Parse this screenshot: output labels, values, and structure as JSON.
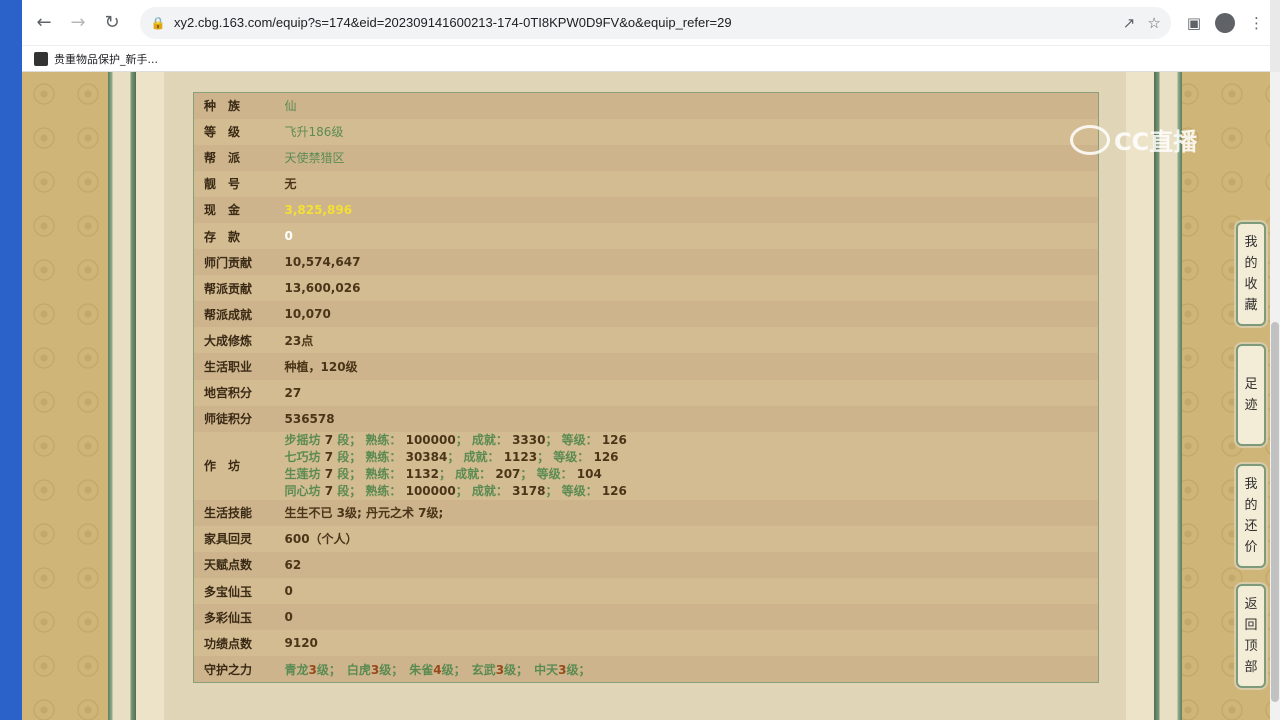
{
  "browser": {
    "url": "xy2.cbg.163.com/equip?s=174&eid=202309141600213-174-0TI8KPW0D9FV&o&equip_refer=29",
    "bookmark": "贵重物品保护_新手..."
  },
  "watermark": "CC直播",
  "rows": [
    {
      "label": "种　族",
      "value": "仙",
      "style": "green"
    },
    {
      "label": "等　级",
      "value": "飞升186级",
      "style": "green"
    },
    {
      "label": "帮　派",
      "value": "天使禁猎区",
      "style": "green"
    },
    {
      "label": "靓　号",
      "value": "无",
      "style": "plain"
    },
    {
      "label": "现　金",
      "value": "3,825,896",
      "style": "yellow"
    },
    {
      "label": "存　款",
      "value": "0",
      "style": "white"
    },
    {
      "label": "师门贡献",
      "value": "10,574,647",
      "style": "plain"
    },
    {
      "label": "帮派贡献",
      "value": "13,600,026",
      "style": "plain"
    },
    {
      "label": "帮派成就",
      "value": "10,070",
      "style": "plain"
    },
    {
      "label": "大成修炼",
      "value": "23点",
      "style": "plain"
    },
    {
      "label": "生活职业",
      "value": "种植，120级",
      "style": "plain"
    },
    {
      "label": "地宫积分",
      "value": "27",
      "style": "plain"
    },
    {
      "label": "师徒积分",
      "value": "536578",
      "style": "plain"
    }
  ],
  "workshop": {
    "label": "作　坊",
    "lines": [
      {
        "name": "步摇坊",
        "duan": "7",
        "shulian": "100000",
        "chengjiu": "3330",
        "dengji": "126"
      },
      {
        "name": "七巧坊",
        "duan": "7",
        "shulian": "30384",
        "chengjiu": "1123",
        "dengji": "126"
      },
      {
        "name": "生莲坊",
        "duan": "7",
        "shulian": "1132",
        "chengjiu": "207",
        "dengji": "104"
      },
      {
        "name": "同心坊",
        "duan": "7",
        "shulian": "100000",
        "chengjiu": "3178",
        "dengji": "126"
      }
    ],
    "words": {
      "duan": "段；",
      "shulian": "熟练：",
      "chengjiu": "成就：",
      "dengji": "等级：",
      "sep": "；"
    }
  },
  "rows2": [
    {
      "label": "生活技能",
      "value": "生生不已 3级; 丹元之术 7级;",
      "style": "plain"
    },
    {
      "label": "家具回灵",
      "value": "600（个人）",
      "style": "plain"
    },
    {
      "label": "天赋点数",
      "value": "62",
      "style": "plain"
    },
    {
      "label": "多宝仙玉",
      "value": "0",
      "style": "plain"
    },
    {
      "label": "多彩仙玉",
      "value": "0",
      "style": "plain"
    },
    {
      "label": "功绩点数",
      "value": "9120",
      "style": "plain"
    }
  ],
  "guard": {
    "label": "守护之力",
    "items": [
      {
        "name": "青龙",
        "level": "3",
        "unit": "级；"
      },
      {
        "name": "白虎",
        "level": "3",
        "unit": "级；"
      },
      {
        "name": "朱雀",
        "level": "4",
        "unit": "级；"
      },
      {
        "name": "玄武",
        "level": "3",
        "unit": "级；"
      },
      {
        "name": "中天",
        "level": "3",
        "unit": "级；"
      }
    ]
  },
  "side_buttons": [
    {
      "name": "favorites",
      "chars": [
        "我",
        "的",
        "收",
        "藏"
      ]
    },
    {
      "name": "footprints",
      "chars": [
        "足",
        "迹"
      ]
    },
    {
      "name": "my-bargain",
      "chars": [
        "我",
        "的",
        "还",
        "价"
      ]
    },
    {
      "name": "back-to-top",
      "chars": [
        "返",
        "回",
        "顶",
        "部"
      ]
    }
  ]
}
